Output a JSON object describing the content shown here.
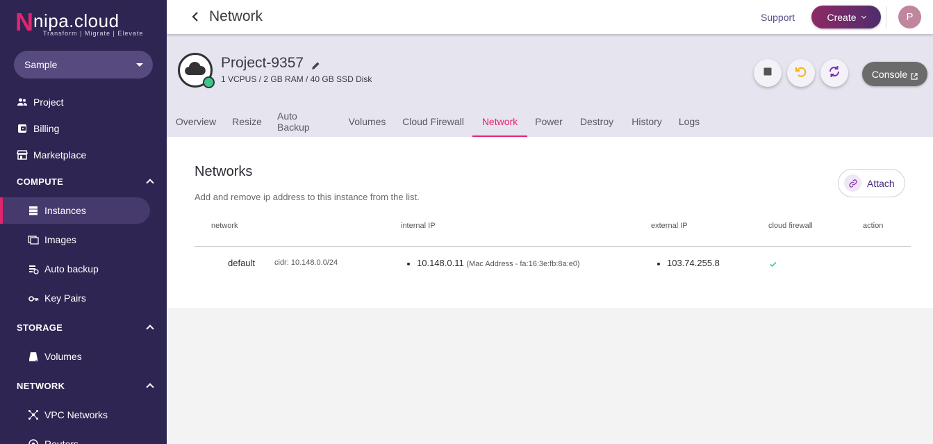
{
  "logo": {
    "mark": "N",
    "word": "nipa.cloud",
    "tagline": "Transform  |  Migrate  |  Elevate"
  },
  "org_select": {
    "value": "Sample"
  },
  "sidebar": {
    "top_items": [
      {
        "label": "Project",
        "icon": "people-icon"
      },
      {
        "label": "Billing",
        "icon": "billing-icon"
      },
      {
        "label": "Marketplace",
        "icon": "store-icon"
      }
    ],
    "sections": [
      {
        "title": "COMPUTE",
        "items": [
          "Instances",
          "Images",
          "Auto backup",
          "Key Pairs"
        ]
      },
      {
        "title": "STORAGE",
        "items": [
          "Volumes"
        ]
      },
      {
        "title": "NETWORK",
        "items": [
          "VPC Networks",
          "Routers"
        ]
      }
    ],
    "active_item": "Instances"
  },
  "topbar": {
    "title": "Network",
    "support": "Support",
    "create": "Create",
    "avatar_initial": "P"
  },
  "instance": {
    "name": "Project-9357",
    "spec": "1 VCPUS / 2 GB RAM / 40 GB SSD Disk",
    "status_color": "#3dc68a",
    "console": "Console"
  },
  "tabs": [
    "Overview",
    "Resize",
    "Auto Backup",
    "Volumes",
    "Cloud Firewall",
    "Network",
    "Power",
    "Destroy",
    "History",
    "Logs"
  ],
  "active_tab": "Network",
  "networks": {
    "title": "Networks",
    "description": "Add and remove ip address to this instance from the list.",
    "attach": "Attach",
    "columns": [
      "network",
      "internal IP",
      "external IP",
      "cloud firewall",
      "action"
    ],
    "rows": [
      {
        "network": "default",
        "cidr": "cidr: 10.148.0.0/24",
        "internal_ip": "10.148.0.11",
        "mac": "(Mac Address - fa:16:3e:fb:8a:e0)",
        "external_ip": "103.74.255.8",
        "cloud_firewall": true
      }
    ]
  },
  "colors": {
    "sidebar": "#2f2552",
    "accent": "#e3246e",
    "create_gradient_start": "#8d2a64",
    "create_gradient_end": "#4f2c6e"
  }
}
